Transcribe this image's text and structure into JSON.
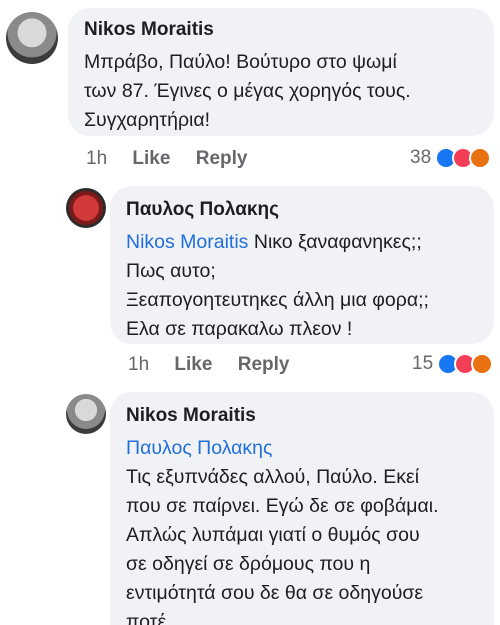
{
  "comments": [
    {
      "author": "Nikos Moraitis",
      "lines": [
        "Μπράβο, Παύλο! Βούτυρο στο ψωμί",
        "των 87. Έγινες ο μέγας χορηγός τους.",
        "Συγχαρητήρια!"
      ],
      "time": "1h",
      "like_label": "Like",
      "reply_label": "Reply",
      "reaction_count": "38"
    },
    {
      "author": "Παυλος Πολακης",
      "mention": "Nikos Moraitis",
      "first_line_rest": " Νικο ξαναφανηκες;;",
      "lines": [
        "Πως αυτο;",
        "Ξεαπογοητευτηκες άλλη μια φορα;;",
        "Ελα σε παρακαλω πλεον !"
      ],
      "time": "1h",
      "like_label": "Like",
      "reply_label": "Reply",
      "reaction_count": "15"
    },
    {
      "author": "Nikos Moraitis",
      "mention": "Παυλος Πολακης",
      "lines": [
        "Τις εξυπνάδες αλλού, Παύλο. Εκεί",
        "που σε παίρνει. Εγώ δε σε φοβάμαι.",
        "Απλώς λυπάμαι γιατί ο θυμός σου",
        "σε οδηγεί σε δρόμους που η",
        "εντιμότητά σου δε θα σε οδηγούσε",
        "ποτέ."
      ]
    }
  ],
  "reaction_icons": [
    "like-icon",
    "love-icon",
    "angry-icon"
  ]
}
